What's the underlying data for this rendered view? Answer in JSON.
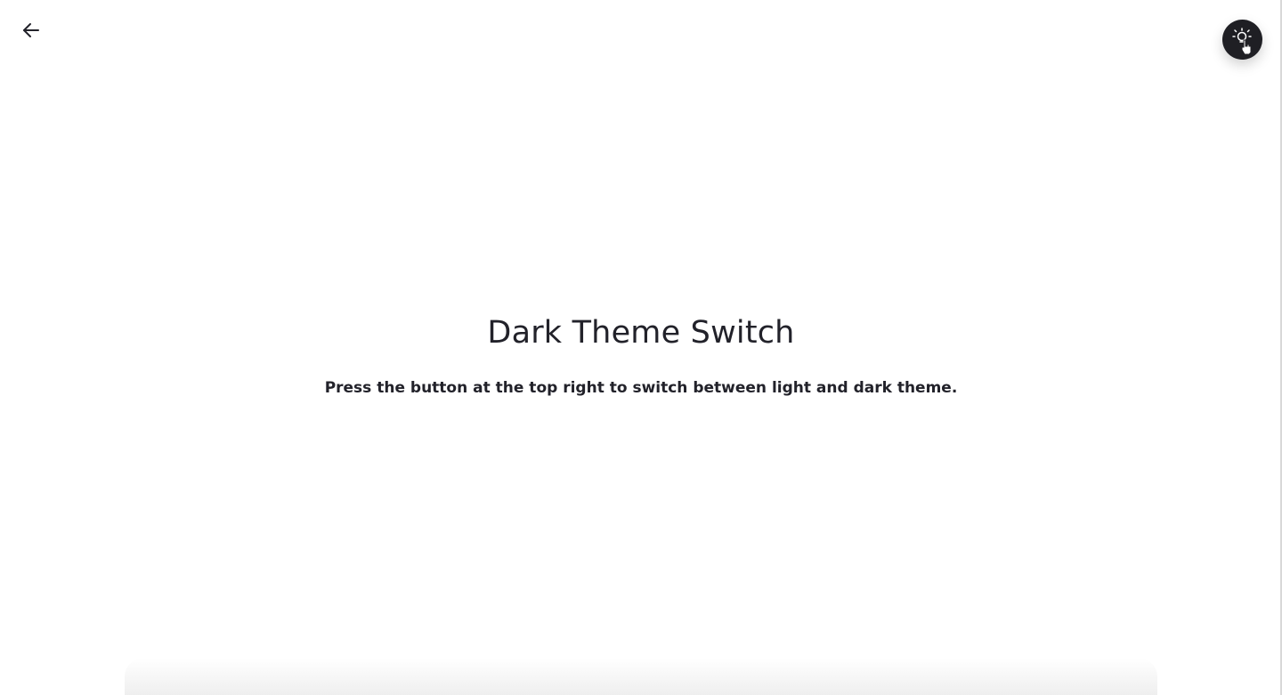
{
  "header": {
    "back_icon": "arrow-left-icon",
    "theme_toggle_icon": "lightbulb-icon",
    "theme_toggle_color": "#1f1f24"
  },
  "main": {
    "title": "Dark Theme Switch",
    "subtitle": "Press the button at the top right to switch between light and dark theme."
  },
  "colors": {
    "background": "#ffffff",
    "text": "#22222a",
    "button": "#1f1f24"
  }
}
